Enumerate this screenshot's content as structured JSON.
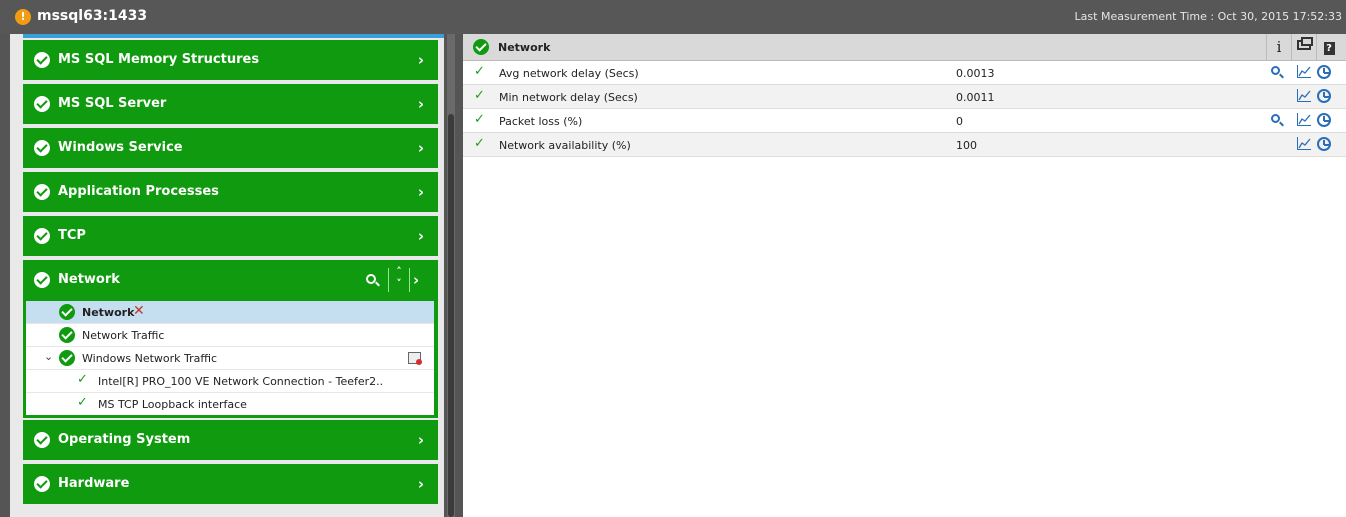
{
  "header": {
    "title": "mssql63:1433",
    "measurement": "Last Measurement Time : Oct 30, 2015 17:52:33"
  },
  "categories": [
    {
      "label": "MS SQL Memory Structures"
    },
    {
      "label": "MS SQL Server"
    },
    {
      "label": "Windows Service"
    },
    {
      "label": "Application Processes"
    },
    {
      "label": "TCP"
    },
    {
      "label": "Network"
    },
    {
      "label": "Operating System"
    },
    {
      "label": "Hardware"
    }
  ],
  "network_tree": [
    {
      "label": "Network"
    },
    {
      "label": "Network Traffic"
    },
    {
      "label": "Windows Network Traffic"
    },
    {
      "label": "Intel[R] PRO_100 VE Network Connection - Teefer2.."
    },
    {
      "label": "MS TCP Loopback interface"
    }
  ],
  "detail": {
    "title": "Network",
    "info_label": "i",
    "help_label": "?",
    "rows": [
      {
        "name": "Avg network delay (Secs)",
        "value": "0.0013"
      },
      {
        "name": "Min network delay (Secs)",
        "value": "0.0011"
      },
      {
        "name": "Packet loss (%)",
        "value": "0"
      },
      {
        "name": "Network availability (%)",
        "value": "100"
      }
    ]
  },
  "glyphs": {
    "chevron": "›",
    "up": "˄",
    "down": "˅",
    "caret": "⌄",
    "tick": "✓",
    "tools": "✕",
    "warning": "!"
  }
}
